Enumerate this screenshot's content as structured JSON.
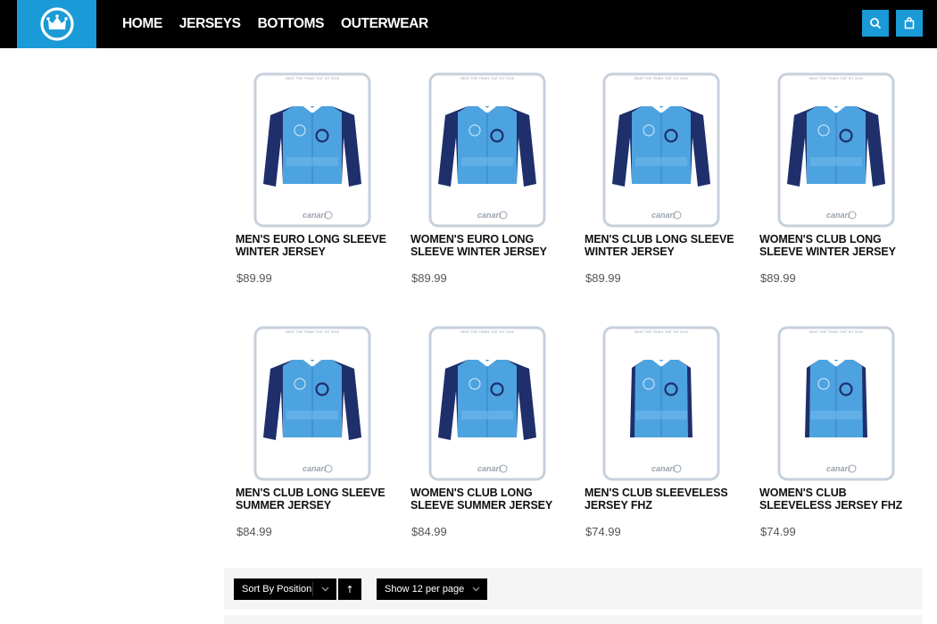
{
  "header": {
    "nav": [
      "HOME",
      "JERSEYS",
      "BOTTOMS",
      "OUTERWEAR"
    ],
    "brand_color": "#1a9ad6"
  },
  "products": [
    {
      "name": "MEN'S EURO LONG SLEEVE WINTER JERSEY",
      "price": "$89.99",
      "style": "long-sleeve",
      "kit_label": "BEAT THE TRAIN \"DIZ\" KIT 2016",
      "maker": "canari"
    },
    {
      "name": "WOMEN'S EURO LONG SLEEVE WINTER JERSEY",
      "price": "$89.99",
      "style": "long-sleeve",
      "kit_label": "BEAT THE TRAIN \"DIZ\" KIT 2016",
      "maker": "canari"
    },
    {
      "name": "MEN'S CLUB LONG SLEEVE WINTER JERSEY",
      "price": "$89.99",
      "style": "long-sleeve",
      "kit_label": "BEAT THE TRAIN \"DIZ\" KIT 2016",
      "maker": "canari"
    },
    {
      "name": "WOMEN'S CLUB LONG SLEEVE WINTER JERSEY",
      "price": "$89.99",
      "style": "long-sleeve",
      "kit_label": "BEAT THE TRAIN \"DIZ\" KIT 2016",
      "maker": "canari"
    },
    {
      "name": "MEN'S CLUB LONG SLEEVE SUMMER JERSEY",
      "price": "$84.99",
      "style": "long-sleeve",
      "kit_label": "BEAT THE TRAIN \"DIZ\" KIT 2016",
      "maker": "canari"
    },
    {
      "name": "WOMEN'S CLUB LONG SLEEVE SUMMER JERSEY",
      "price": "$84.99",
      "style": "long-sleeve",
      "kit_label": "BEAT THE TRAIN \"DIZ\" KIT 2016",
      "maker": "canari"
    },
    {
      "name": "MEN'S CLUB SLEEVELESS JERSEY FHZ",
      "price": "$74.99",
      "style": "sleeveless",
      "kit_label": "BEAT THE TRAIN \"DIZ\" KIT 2016",
      "maker": "canari"
    },
    {
      "name": "WOMEN'S CLUB SLEEVELESS JERSEY FHZ",
      "price": "$74.99",
      "style": "sleeveless",
      "kit_label": "BEAT THE TRAIN \"DIZ\" KIT 2016",
      "maker": "canari"
    }
  ],
  "toolbar": {
    "sort_prefix": "Sort By",
    "sort_value": "Position",
    "sort_dir_icon": "↑",
    "limiter": "Show 12 per page"
  }
}
